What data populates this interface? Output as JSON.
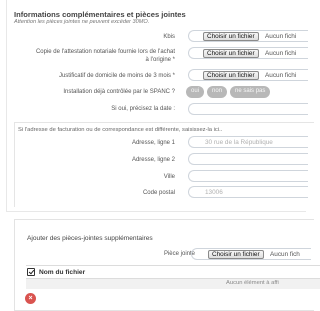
{
  "section": {
    "title": "Informations complémentaires et pièces jointes",
    "note": "Attention les pièces jointes ne peuvent excéder 30MO."
  },
  "file_input": {
    "button_label": "Choisir un fichier",
    "status": "Aucun fichi"
  },
  "fields": {
    "kbis": "Kbis",
    "attestation": "Copie de l'attestation notariale fournie lors de l'achat",
    "attestation_line2": "à l'origine *",
    "domicile": "Justificatif de domicile de moins de 3 mois *",
    "spanc": "Installation déjà contrôlée par le SPANC ?",
    "date": "Si oui, précisez la date :"
  },
  "spanc_options": [
    "oui",
    "non",
    "ne sais pas"
  ],
  "address": {
    "note": "Si l'adresse de facturation ou de correspondance est différente, saisissez-la ici..",
    "line1_label": "Adresse, ligne 1",
    "line1_value": "30 rue de la République",
    "line2_label": "Adresse, ligne 2",
    "city_label": "Ville",
    "postal_label": "Code postal",
    "postal_value": "13006"
  },
  "attachments": {
    "title": "Ajouter des pièces-jointes supplémentaires",
    "file_label": "Pièce jointe",
    "file_status": "Aucun fich",
    "column_header": "Nom du fichier",
    "empty_text": "Aucun élément à affi",
    "delete_icon": "×"
  }
}
